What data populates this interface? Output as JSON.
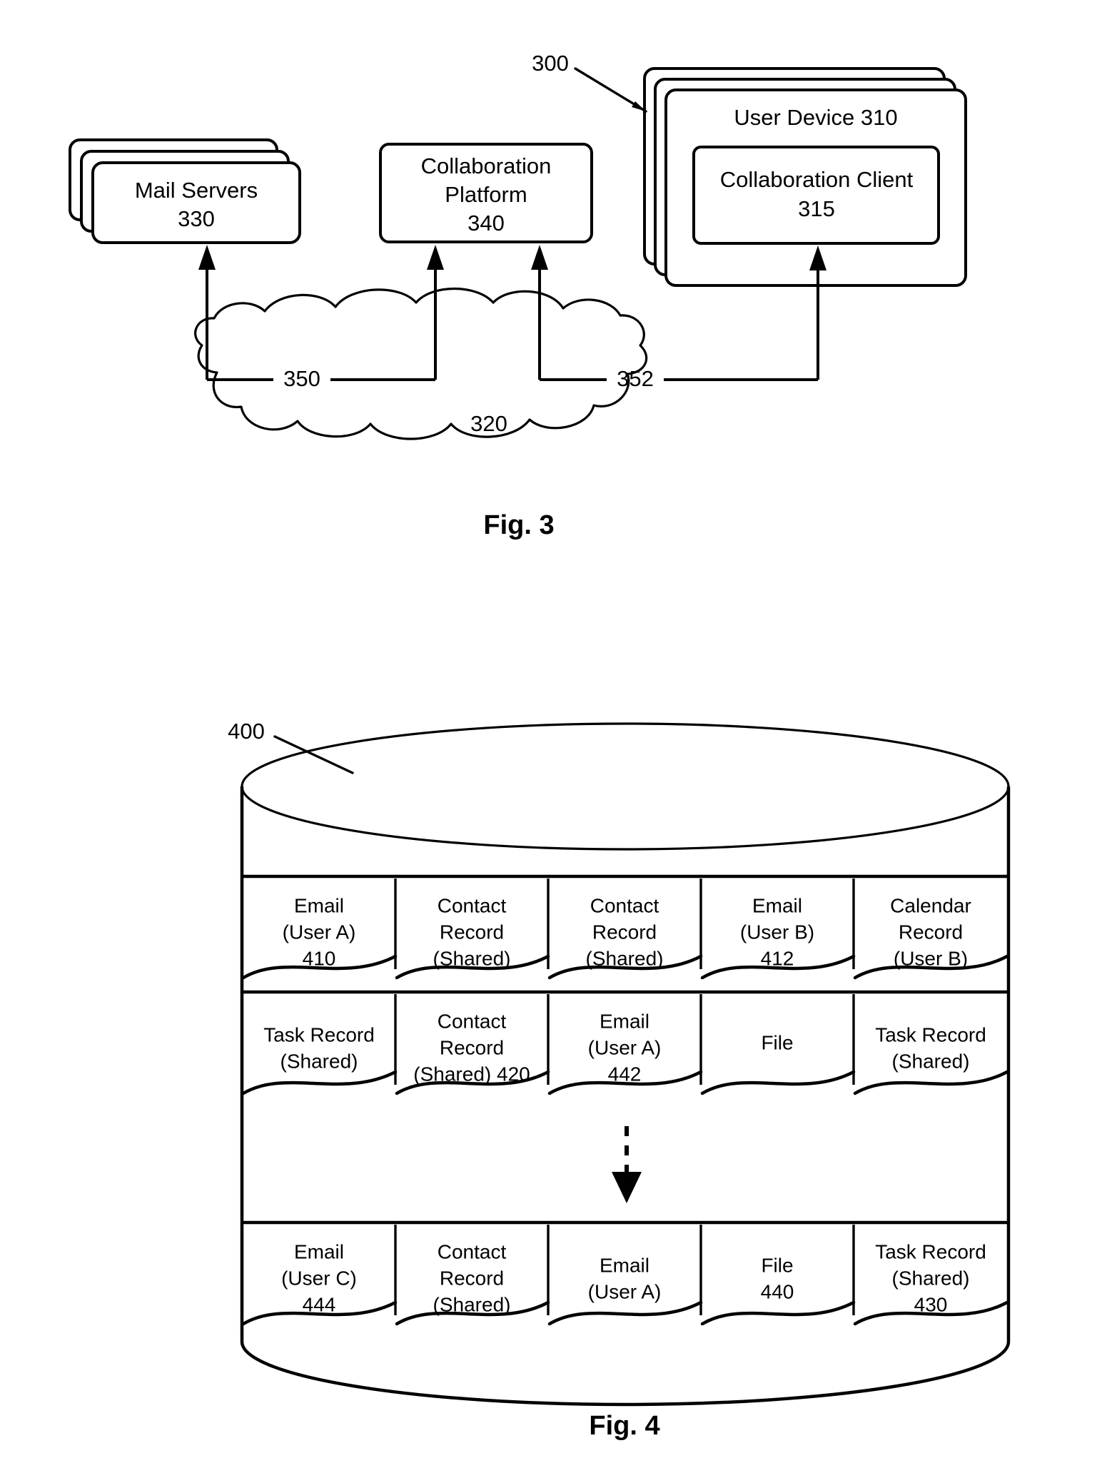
{
  "figures": [
    {
      "caption": "Fig. 3",
      "system_ref": "300",
      "nodes": {
        "mail_servers": {
          "line1": "Mail Servers",
          "line2": "330"
        },
        "collaboration_platform": {
          "line1": "Collaboration",
          "line2": "Platform",
          "line3": "340"
        },
        "user_device": {
          "line1": "User Device 310"
        },
        "collaboration_client": {
          "line1": "Collaboration Client",
          "line2": "315"
        }
      },
      "network": {
        "cloud_ref": "320",
        "link_left_ref": "350",
        "link_right_ref": "352"
      }
    },
    {
      "caption": "Fig. 4",
      "store_ref": "400",
      "rows": [
        {
          "cells": [
            {
              "lines": [
                "Email",
                "(User A)",
                "410"
              ]
            },
            {
              "lines": [
                "Contact",
                "Record",
                "(Shared)"
              ]
            },
            {
              "lines": [
                "Contact",
                "Record",
                "(Shared)"
              ]
            },
            {
              "lines": [
                "Email",
                "(User B)",
                "412"
              ]
            },
            {
              "lines": [
                "Calendar",
                "Record",
                "(User B)"
              ]
            }
          ]
        },
        {
          "cells": [
            {
              "lines": [
                "Task Record",
                "(Shared)"
              ]
            },
            {
              "lines": [
                "Contact",
                "Record",
                "(Shared) 420"
              ]
            },
            {
              "lines": [
                "Email",
                "(User A)",
                "442"
              ]
            },
            {
              "lines": [
                "File"
              ]
            },
            {
              "lines": [
                "Task Record",
                "(Shared)"
              ]
            }
          ]
        },
        {
          "cells": [
            {
              "lines": [
                "Email",
                "(User C)",
                "444"
              ]
            },
            {
              "lines": [
                "Contact",
                "Record",
                "(Shared)"
              ]
            },
            {
              "lines": [
                "Email",
                "(User A)"
              ]
            },
            {
              "lines": [
                "File",
                "440"
              ]
            },
            {
              "lines": [
                "Task Record",
                "(Shared)",
                "430"
              ]
            }
          ]
        }
      ]
    }
  ]
}
